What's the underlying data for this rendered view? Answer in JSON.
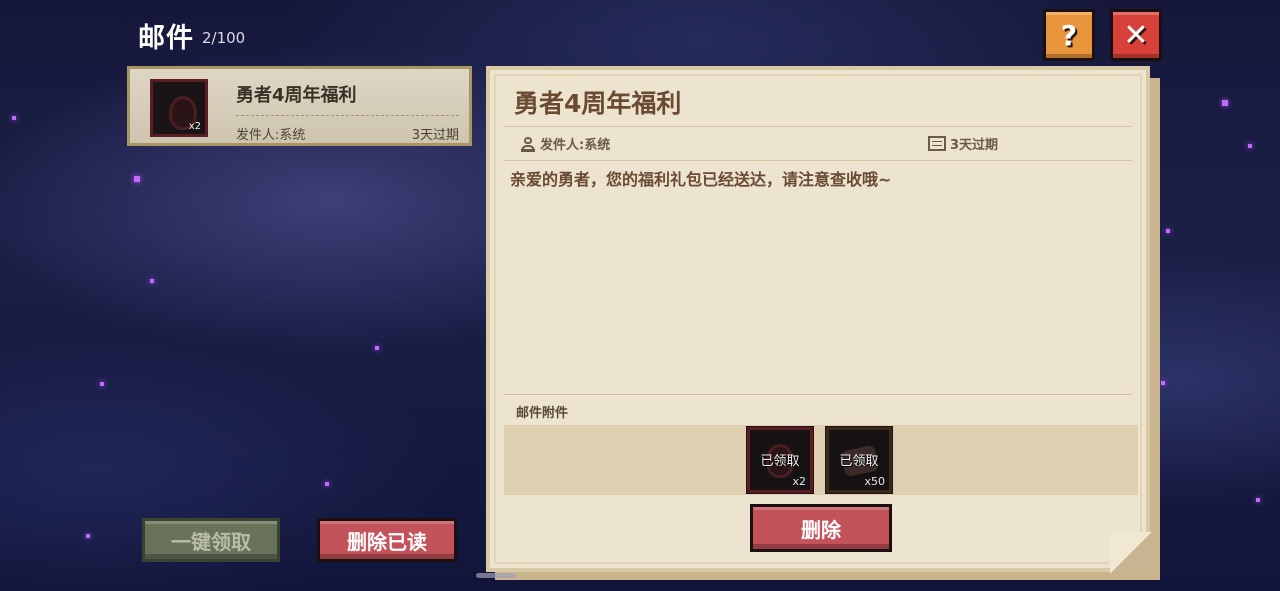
{
  "header": {
    "title": "邮件",
    "count": "2/100",
    "help_glyph": "?",
    "close_glyph": "✕"
  },
  "mail_list": [
    {
      "title": "勇者4周年福利",
      "sender": "发件人:系统",
      "expiry": "3天过期",
      "thumb_count": "x2",
      "selected": true
    }
  ],
  "detail": {
    "title": "勇者4周年福利",
    "sender": "发件人:系统",
    "expiry": "3天过期",
    "body": "亲爱的勇者，您的福利礼包已经送达，请注意查收哦~",
    "attachments_label": "邮件附件",
    "attachments": [
      {
        "status": "已领取",
        "count": "x2",
        "icon": "potion-icon"
      },
      {
        "status": "已领取",
        "count": "x50",
        "icon": "ore-icon"
      }
    ],
    "delete_label": "删除"
  },
  "actions": {
    "claim_all_label": "一键领取",
    "delete_read_label": "删除已读"
  },
  "colors": {
    "delete_button": "#c4525a",
    "claim_all_button": "#68735a",
    "help_button": "#e8943a",
    "close_button": "#d8403a",
    "panel_bg": "#ece4ce",
    "panel_title": "#6b4a33"
  }
}
